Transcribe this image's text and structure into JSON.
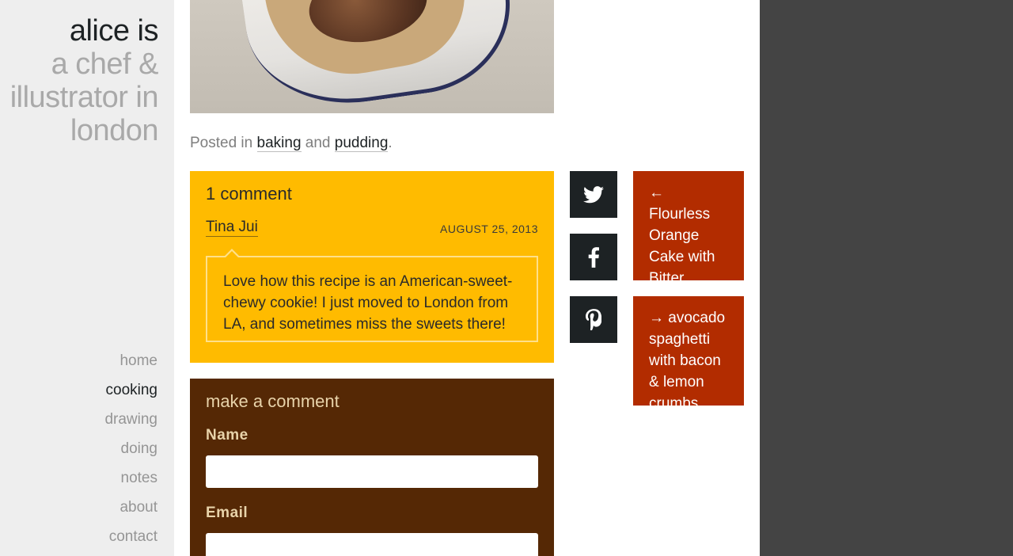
{
  "site": {
    "title_line1": "alice is",
    "title_line2": "a chef & illustrator in london"
  },
  "nav": {
    "items": [
      "home",
      "cooking",
      "drawing",
      "doing",
      "notes",
      "about",
      "contact"
    ],
    "active": "cooking"
  },
  "post": {
    "posted_prefix": "Posted in",
    "category1": "baking",
    "conjunction": "and",
    "category2": "pudding",
    "suffix": "."
  },
  "comments": {
    "heading": "1 comment",
    "author": "Tina Jui",
    "date": "AUGUST 25, 2013",
    "text": "Love how this recipe is an American-sweet-chewy cookie! I just moved to London from LA, and sometimes miss the sweets there!"
  },
  "form": {
    "heading": "make a comment",
    "name_label": "Name",
    "email_label": "Email",
    "name_value": "",
    "email_value": ""
  },
  "share": {
    "icons": [
      "twitter-icon",
      "facebook-icon",
      "pinterest-icon"
    ]
  },
  "post_nav": {
    "prev": "← Flourless Orange Cake with Bitter Chocolate",
    "next": "→ avocado spaghetti with bacon & lemon crumbs"
  },
  "colors": {
    "sidebar_bg": "#eeeeee",
    "comments_bg": "#ffbb00",
    "form_bg": "#552805",
    "share_bg": "#1d2224",
    "post_nav_bg": "#b22c00",
    "page_bg": "#444444"
  }
}
